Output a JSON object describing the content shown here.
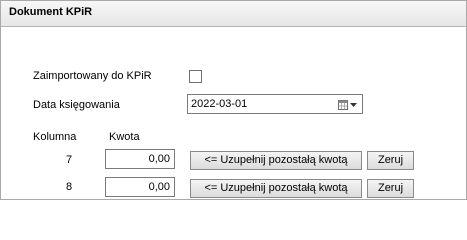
{
  "header": {
    "title": "Dokument KPiR"
  },
  "form": {
    "imported_label": "Zaimportowany do KPiR",
    "imported_checked": false,
    "date_label": "Data księgowania",
    "date_value": "2022-03-01",
    "col_header_kolumna": "Kolumna",
    "col_header_kwota": "Kwota",
    "rows": [
      {
        "column": "7",
        "amount": "0,00",
        "fill_label": "<= Uzupełnij pozostałą kwotą",
        "reset_label": "Zeruj"
      },
      {
        "column": "8",
        "amount": "0,00",
        "fill_label": "<= Uzupełnij pozostałą kwotą",
        "reset_label": "Zeruj"
      }
    ]
  },
  "icons": {
    "calendar": "calendar-dropdown-icon"
  }
}
